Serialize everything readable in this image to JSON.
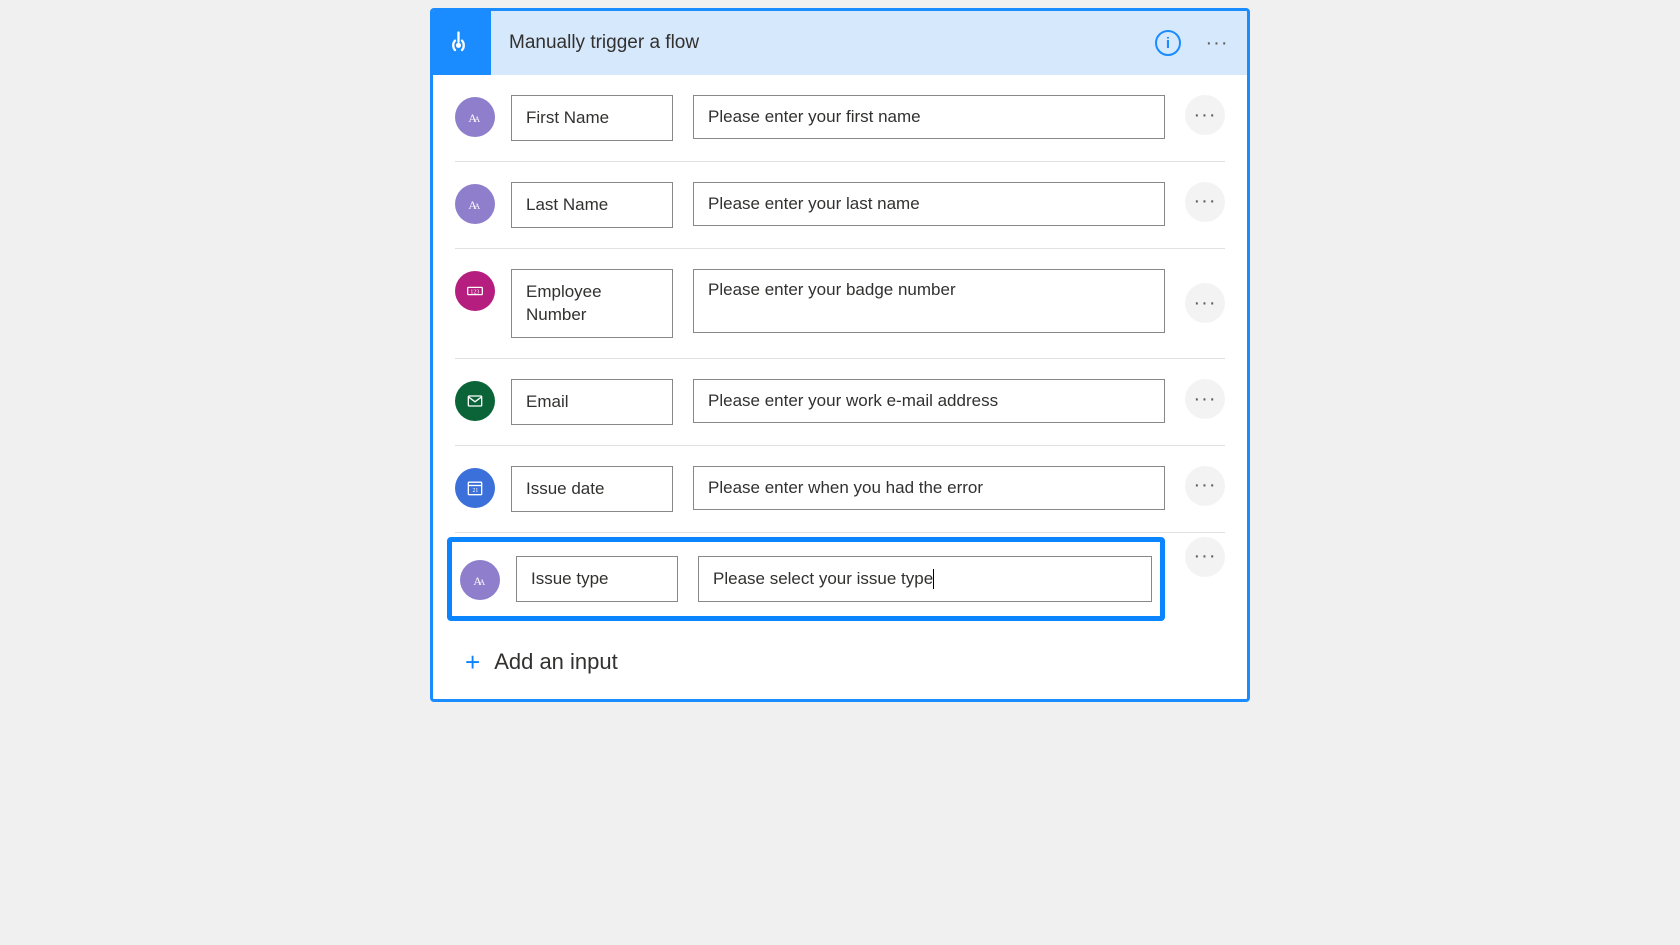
{
  "header": {
    "title": "Manually trigger a flow"
  },
  "inputs": [
    {
      "type": "text",
      "name": "First Name",
      "placeholder": "Please enter your first name"
    },
    {
      "type": "text",
      "name": "Last Name",
      "placeholder": "Please enter your last name"
    },
    {
      "type": "number",
      "name": "Employee Number",
      "placeholder": "Please enter your badge number"
    },
    {
      "type": "email",
      "name": "Email",
      "placeholder": "Please enter your work e-mail address"
    },
    {
      "type": "date",
      "name": "Issue date",
      "placeholder": "Please enter when you had the error"
    },
    {
      "type": "text",
      "name": "Issue type",
      "placeholder": "Please select your issue type",
      "highlighted": true,
      "active": true
    }
  ],
  "actions": {
    "add_input": "Add an input"
  }
}
